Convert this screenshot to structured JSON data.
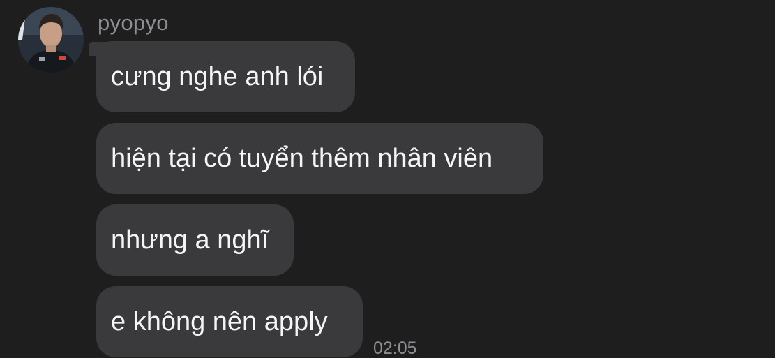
{
  "conversation": {
    "sender_name": "pyopyo",
    "messages": [
      {
        "text": "cưng nghe anh lói"
      },
      {
        "text": "hiện tại có tuyển thêm nhân viên"
      },
      {
        "text": "nhưng a nghĩ"
      },
      {
        "text": "e không nên apply"
      }
    ],
    "timestamp": "02:05"
  },
  "theme": {
    "background": "#1e1e1f",
    "bubble_color": "#3a3a3c",
    "text_color": "#f5f5f7",
    "meta_color": "#8e8e93"
  }
}
